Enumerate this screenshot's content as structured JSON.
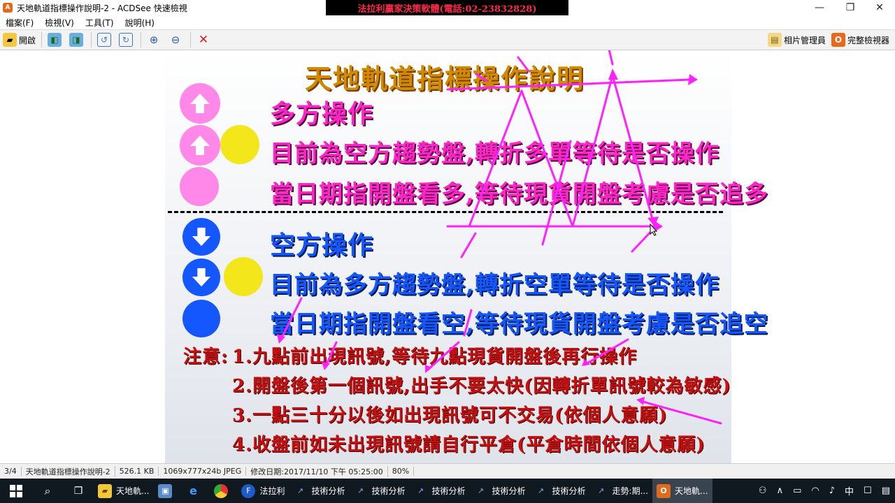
{
  "window": {
    "title": "天地軌道指標操作說明-2 - ACDSee 快速檢視",
    "banner": "法拉利贏家決策軟體(電話:02-23832828)"
  },
  "menu": [
    "檔案(F)",
    "檢視(V)",
    "工具(T)",
    "說明(H)"
  ],
  "toolbar": {
    "open_label": "開啟",
    "photo_manager_label": "相片管理員",
    "full_viewer_label": "完整檢視器"
  },
  "slide": {
    "title": "天地軌道指標操作說明",
    "long_heading": "多方操作",
    "long_line1": "目前為空方趨勢盤,轉折多單等待是否操作",
    "long_line2": "當日期指開盤看多,等待現貨開盤考慮是否追多",
    "short_heading": "空方操作",
    "short_line1": "目前為多方趨勢盤,轉折空單等待是否操作",
    "short_line2": "當日期指開盤看空,等待現貨開盤考慮是否追空",
    "note_label": "注意:",
    "notes": [
      "1.九點前出現訊號,等待九點現貨開盤後再行操作",
      "2.開盤後第一個訊號,出手不要太快(因轉折單訊號較為敏感)",
      "3.一點三十分以後如出現訊號可不交易(依個人意願)",
      "4.收盤前如未出現訊號請自行平倉(平倉時間依個人意願)"
    ]
  },
  "status": {
    "index": "3/4",
    "filename": "天地軌道指標操作說明-2",
    "size": "526.1 KB",
    "dims": "1069x777x24b JPEG",
    "modified": "修改日期:2017/11/10 下午 05:25:00",
    "zoom": "80%"
  },
  "taskbar": {
    "items": [
      "天地軌...",
      "法拉利",
      "技術分析",
      "技術分析",
      "技術分析",
      "技術分析",
      "技術分析",
      "走勢:期...",
      "天地軌..."
    ],
    "tray_ime": "中"
  },
  "colors": {
    "pink": "#ff26c8",
    "blue": "#1457ff",
    "yellow": "#f3e61b",
    "annotation": "#ff22ff"
  }
}
